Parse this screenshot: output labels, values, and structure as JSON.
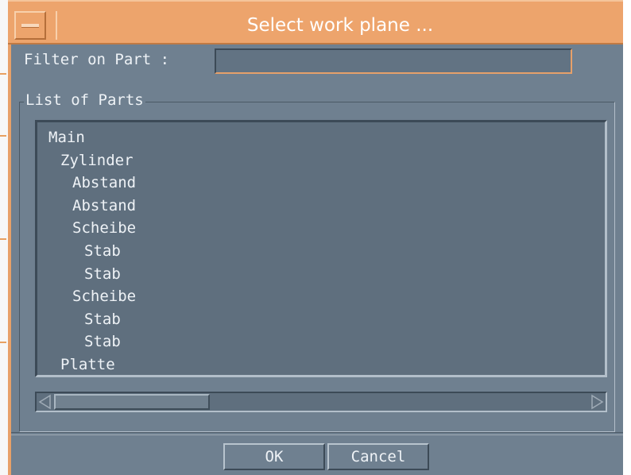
{
  "window": {
    "title": "Select work plane ...",
    "accent_color": "#eda46c",
    "panel_color": "#6f8090"
  },
  "filter": {
    "label": "Filter on Part :",
    "value": ""
  },
  "parts_group": {
    "title": "List of Parts",
    "items": [
      {
        "label": "Main",
        "level": 0
      },
      {
        "label": "Zylinder",
        "level": 1
      },
      {
        "label": "Abstand",
        "level": 2
      },
      {
        "label": "Abstand",
        "level": 2
      },
      {
        "label": "Scheibe",
        "level": 2
      },
      {
        "label": "Stab",
        "level": 3
      },
      {
        "label": "Stab",
        "level": 3
      },
      {
        "label": "Scheibe",
        "level": 2
      },
      {
        "label": "Stab",
        "level": 3
      },
      {
        "label": "Stab",
        "level": 3
      },
      {
        "label": "Platte",
        "level": 1
      }
    ]
  },
  "buttons": {
    "ok": "OK",
    "cancel": "Cancel"
  },
  "icons": {
    "window_menu": "window-menu-icon",
    "scroll_left": "arrow-left-icon",
    "scroll_right": "arrow-right-icon"
  }
}
